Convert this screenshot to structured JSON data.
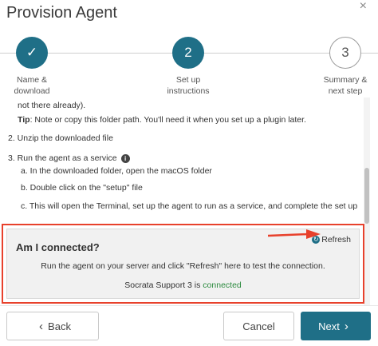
{
  "dialog": {
    "title": "Provision Agent",
    "close_icon": "close-icon"
  },
  "steps": [
    {
      "number": "✓",
      "label_line1": "Name &",
      "label_line2": "download",
      "state": "done"
    },
    {
      "number": "2",
      "label_line1": "Set up",
      "label_line2": "instructions",
      "state": "active"
    },
    {
      "number": "3",
      "label_line1": "Summary &",
      "label_line2": "next step",
      "state": "todo"
    }
  ],
  "instructions": {
    "cutoff_line": "not there already).",
    "tip_label": "Tip",
    "tip_text": ": Note or copy this folder path. You'll need it when you set up a plugin later.",
    "step2": "2. Unzip the downloaded file",
    "step3": "3. Run the agent as a service",
    "step3a": "a. In the downloaded folder, open the macOS folder",
    "step3b": "b. Double click on the \"setup\" file",
    "step3c": "c. This will open the Terminal, set up the agent to run as a service, and complete the set up"
  },
  "connection": {
    "title": "Am I connected?",
    "refresh_label": "Refresh",
    "message": "Run the agent on your server and click \"Refresh\" here to test the connection.",
    "status_prefix": "Socrata Support 3 is ",
    "status_value": "connected"
  },
  "footer": {
    "back_label": "Back",
    "cancel_label": "Cancel",
    "next_label": "Next"
  },
  "colors": {
    "accent": "#1f6f87",
    "highlight": "#e8412c",
    "connected": "#2b8a3e"
  }
}
